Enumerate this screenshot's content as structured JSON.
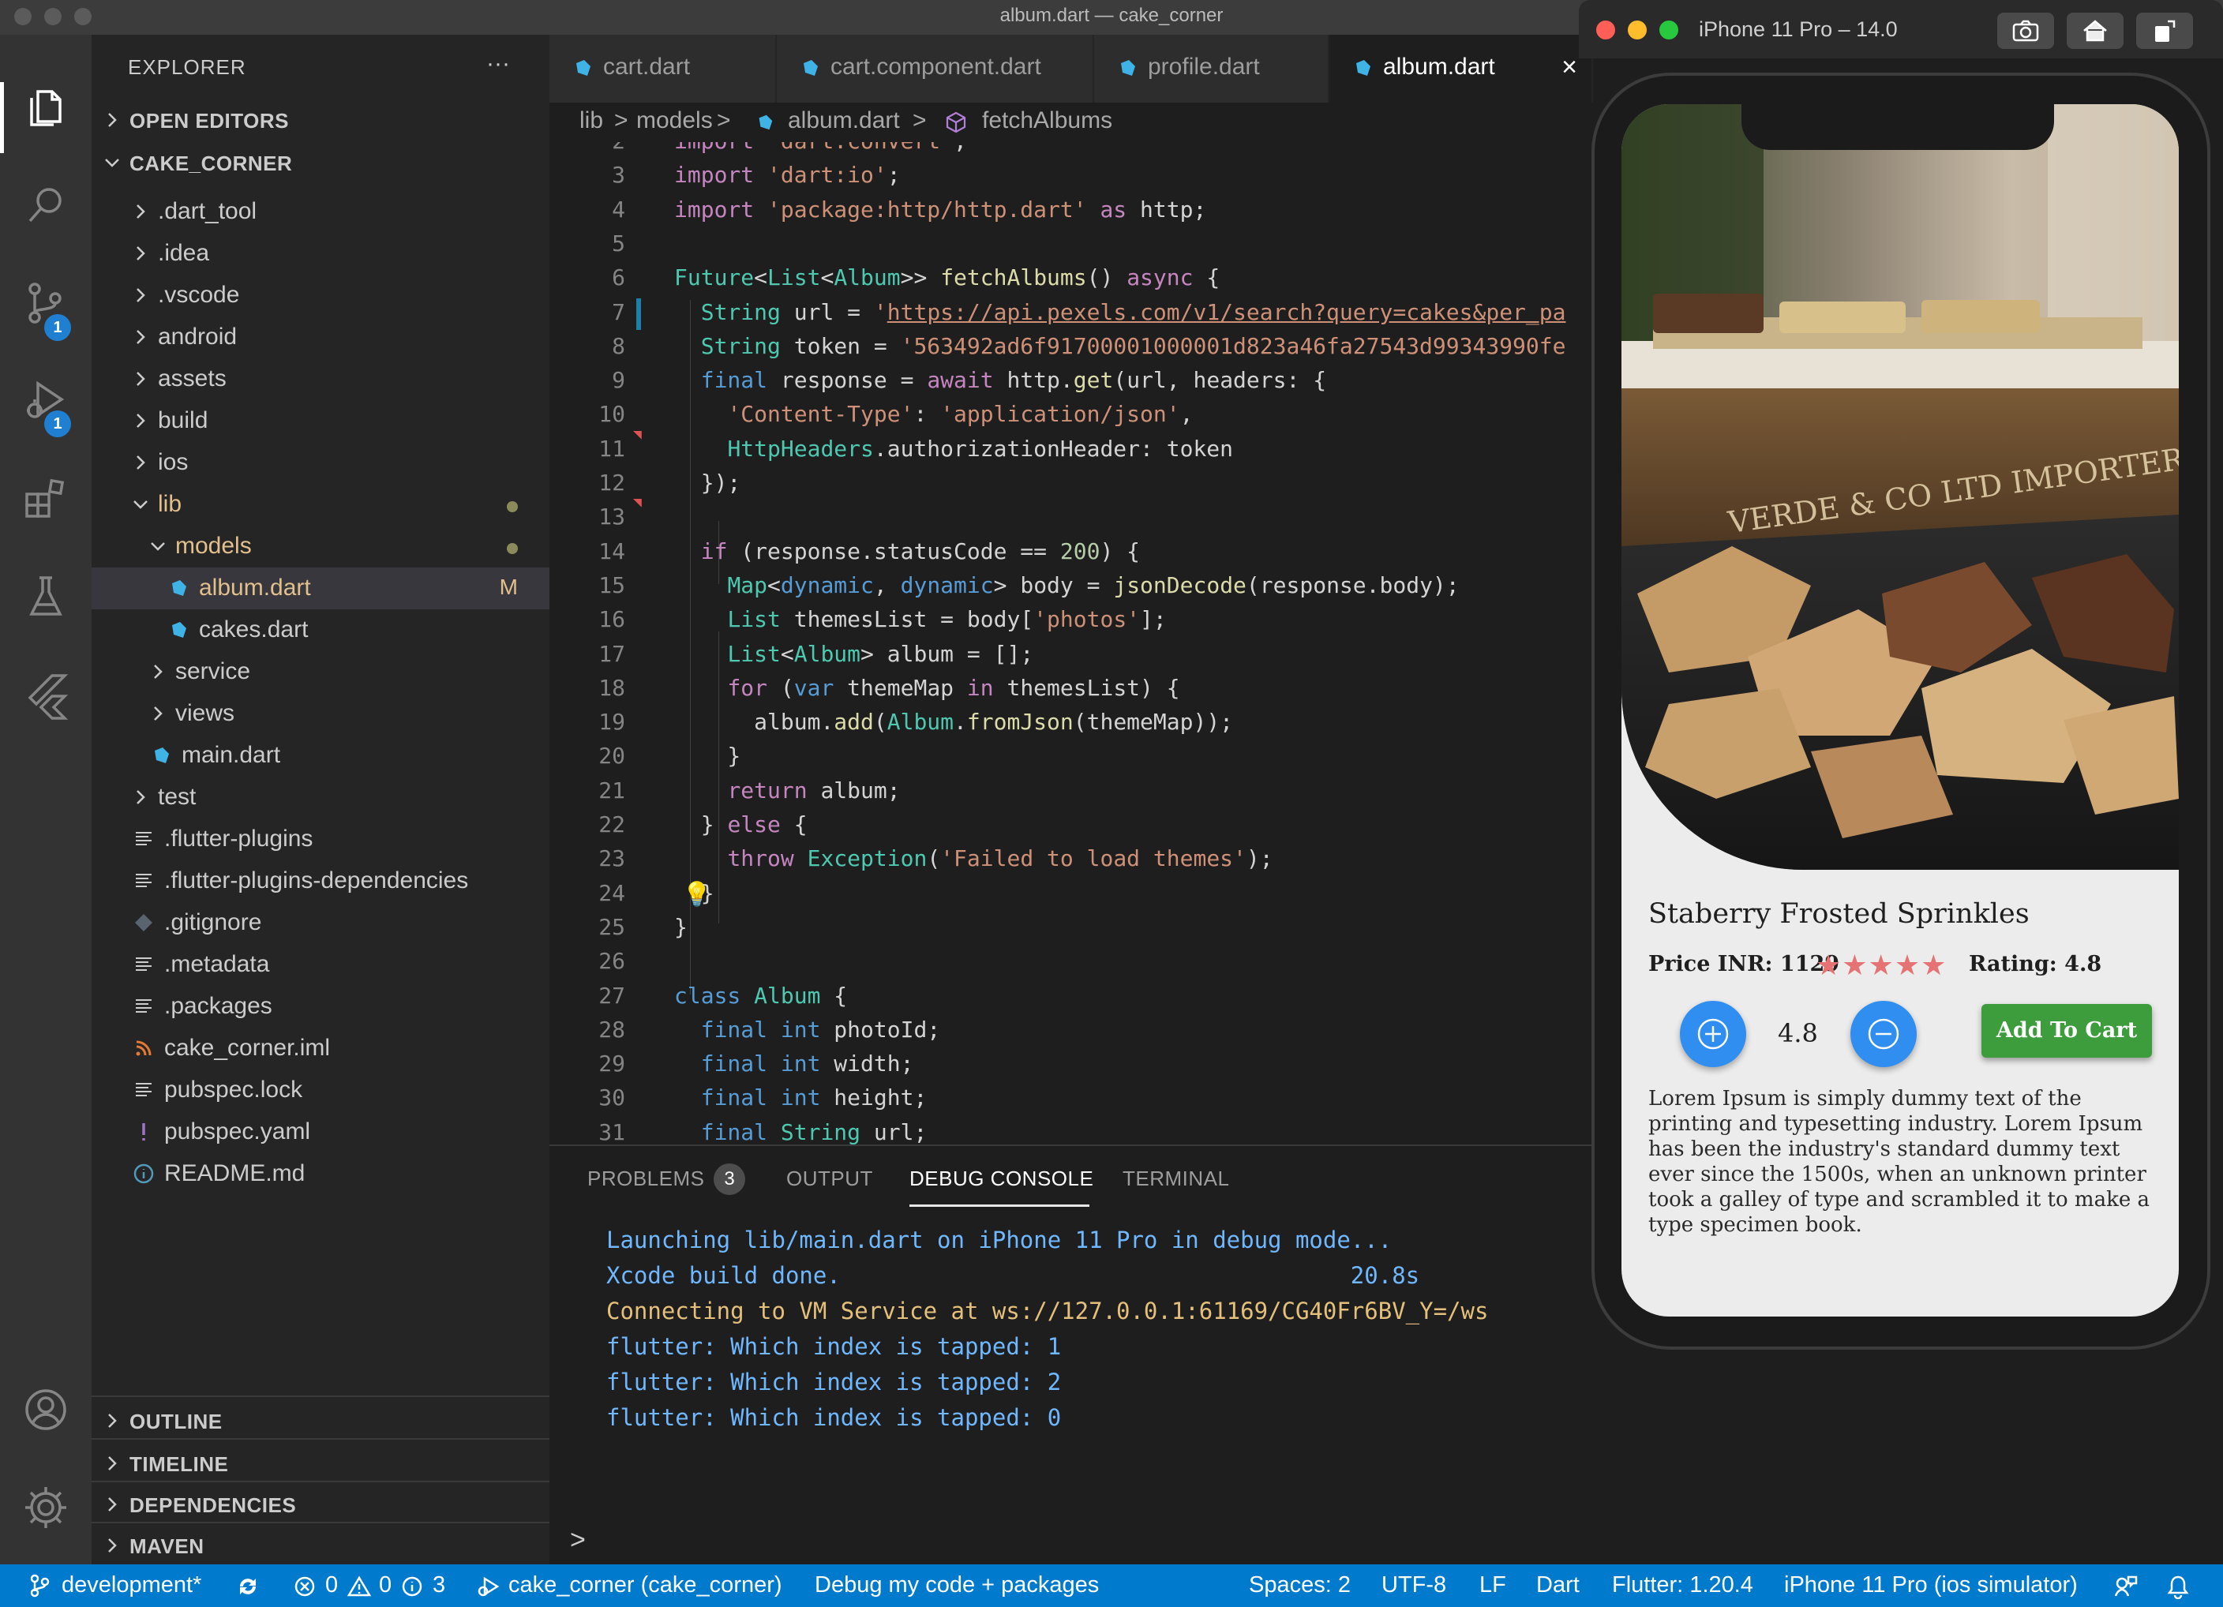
{
  "window": {
    "title": "album.dart — cake_corner"
  },
  "explorer": {
    "title": "EXPLORER",
    "more": "···",
    "open_editors": "OPEN EDITORS",
    "project": "CAKE_CORNER",
    "items": [
      {
        "label": ".dart_tool",
        "type": "folder"
      },
      {
        "label": ".idea",
        "type": "folder"
      },
      {
        "label": ".vscode",
        "type": "folder"
      },
      {
        "label": "android",
        "type": "folder"
      },
      {
        "label": "assets",
        "type": "folder"
      },
      {
        "label": "build",
        "type": "folder"
      },
      {
        "label": "ios",
        "type": "folder"
      },
      {
        "label": "lib",
        "type": "folder-open"
      },
      {
        "label": "models",
        "type": "folder-open"
      },
      {
        "label": "album.dart",
        "type": "dart",
        "badge": "M"
      },
      {
        "label": "cakes.dart",
        "type": "dart"
      },
      {
        "label": "service",
        "type": "folder"
      },
      {
        "label": "views",
        "type": "folder"
      },
      {
        "label": "main.dart",
        "type": "dart"
      },
      {
        "label": "test",
        "type": "folder"
      },
      {
        "label": ".flutter-plugins",
        "type": "file"
      },
      {
        "label": ".flutter-plugins-dependencies",
        "type": "file"
      },
      {
        "label": ".gitignore",
        "type": "git"
      },
      {
        "label": ".metadata",
        "type": "file"
      },
      {
        "label": ".packages",
        "type": "file"
      },
      {
        "label": "cake_corner.iml",
        "type": "rss"
      },
      {
        "label": "pubspec.lock",
        "type": "file"
      },
      {
        "label": "pubspec.yaml",
        "type": "yaml"
      },
      {
        "label": "README.md",
        "type": "info"
      }
    ],
    "bottom_sections": [
      "OUTLINE",
      "TIMELINE",
      "DEPENDENCIES",
      "MAVEN"
    ]
  },
  "activity": {
    "scm_badge": "1",
    "debug_badge": "1"
  },
  "tabs": [
    {
      "label": "cart.dart"
    },
    {
      "label": "cart.component.dart"
    },
    {
      "label": "profile.dart"
    },
    {
      "label": "album.dart",
      "active": true,
      "close": "×"
    }
  ],
  "breadcrumb": {
    "p1": "lib",
    "p2": "models",
    "p3": "album.dart",
    "p4": "fetchAlbums",
    "sep": ">"
  },
  "code": {
    "lines": [
      {
        "n": "2",
        "html": "<span class=\"kw2\">import</span> <span class=\"str\">'dart:convert'</span>;"
      },
      {
        "n": "3",
        "html": "<span class=\"kw2\">import</span> <span class=\"str\">'dart:io'</span>;"
      },
      {
        "n": "4",
        "html": "<span class=\"kw2\">import</span> <span class=\"str\">'package:http/http.dart'</span> <span class=\"kw2\">as</span> http;"
      },
      {
        "n": "5",
        "html": ""
      },
      {
        "n": "6",
        "html": "<span class=\"ty\">Future</span>&lt;<span class=\"ty\">List</span>&lt;<span class=\"ty\">Album</span>&gt;&gt; <span class=\"fn\">fetchAlbums</span>() <span class=\"kw2\">async</span> {"
      },
      {
        "n": "7",
        "html": "  <span class=\"ty\">String</span> url = <span class=\"str\">'</span><span class=\"url\">https://api.pexels.com/v1/search?query=cakes&amp;per_pa</span>"
      },
      {
        "n": "8",
        "html": "  <span class=\"ty\">String</span> token = <span class=\"str\">'563492ad6f91700001000001d823a46fa27543d99343990fe</span>"
      },
      {
        "n": "9",
        "html": "  <span class=\"kw\">final</span> response = <span class=\"kw2\">await</span> http.<span class=\"fn\">get</span>(url, headers: {"
      },
      {
        "n": "10",
        "html": "    <span class=\"str\">'Content-Type'</span>: <span class=\"str\">'application/json'</span>,"
      },
      {
        "n": "11",
        "html": "    <span class=\"ty\">HttpHeaders</span>.authorizationHeader: token"
      },
      {
        "n": "12",
        "html": "  });"
      },
      {
        "n": "13",
        "html": ""
      },
      {
        "n": "14",
        "html": "  <span class=\"kw2\">if</span> (response.statusCode == <span class=\"num\">200</span>) {"
      },
      {
        "n": "15",
        "html": "    <span class=\"ty\">Map</span>&lt;<span class=\"kw\">dynamic</span>, <span class=\"kw\">dynamic</span>&gt; body = <span class=\"fn\">jsonDecode</span>(response.body);"
      },
      {
        "n": "16",
        "html": "    <span class=\"ty\">List</span> themesList = body[<span class=\"str\">'photos'</span>];"
      },
      {
        "n": "17",
        "html": "    <span class=\"ty\">List</span>&lt;<span class=\"ty\">Album</span>&gt; album = [];"
      },
      {
        "n": "18",
        "html": "    <span class=\"kw2\">for</span> (<span class=\"kw\">var</span> themeMap <span class=\"kw2\">in</span> themesList) {"
      },
      {
        "n": "19",
        "html": "      album.<span class=\"fn\">add</span>(<span class=\"ty\">Album</span>.<span class=\"fn\">fromJson</span>(themeMap));"
      },
      {
        "n": "20",
        "html": "    }"
      },
      {
        "n": "21",
        "html": "    <span class=\"kw2\">return</span> album;"
      },
      {
        "n": "22",
        "html": "  } <span class=\"kw2\">else</span> {"
      },
      {
        "n": "23",
        "html": "    <span class=\"kw2\">throw</span> <span class=\"ty\">Exception</span>(<span class=\"str\">'Failed to load themes'</span>);"
      },
      {
        "n": "24",
        "html": "  }"
      },
      {
        "n": "25",
        "html": "}"
      },
      {
        "n": "26",
        "html": ""
      },
      {
        "n": "27",
        "html": "<span class=\"kw\">class</span> <span class=\"ty\">Album</span> {"
      },
      {
        "n": "28",
        "html": "  <span class=\"kw\">final</span> <span class=\"kw\">int</span> photoId;"
      },
      {
        "n": "29",
        "html": "  <span class=\"kw\">final</span> <span class=\"kw\">int</span> width;"
      },
      {
        "n": "30",
        "html": "  <span class=\"kw\">final</span> <span class=\"kw\">int</span> height;"
      },
      {
        "n": "31",
        "html": "  <span class=\"kw\">final</span> <span class=\"ty\">String</span> url;"
      }
    ]
  },
  "panel": {
    "tabs": {
      "problems": "PROBLEMS",
      "problems_count": "3",
      "output": "OUTPUT",
      "debug": "DEBUG CONSOLE",
      "terminal": "TERMINAL"
    },
    "console": [
      {
        "text": "Launching lib/main.dart on iPhone 11 Pro in debug mode...",
        "color": "#6fb8ff"
      },
      {
        "text": "Xcode build done.                                     20.8s",
        "color": "#6fb8ff"
      },
      {
        "text": "Connecting to VM Service at ws://127.0.0.1:61169/CG40Fr6BV_Y=/ws",
        "color": "#e5c07b"
      },
      {
        "text": "flutter: Which index is tapped: 1",
        "color": "#6fb8ff"
      },
      {
        "text": "flutter: Which index is tapped: 2",
        "color": "#6fb8ff"
      },
      {
        "text": "flutter: Which index is tapped: 0",
        "color": "#6fb8ff"
      }
    ],
    "prompt": ">"
  },
  "status": {
    "branch": "development*",
    "errors": "0",
    "warnings": "0",
    "infos": "3",
    "project": "cake_corner (cake_corner)",
    "debug": "Debug my code + packages",
    "spaces": "Spaces: 2",
    "encoding": "UTF-8",
    "eol": "LF",
    "language": "Dart",
    "flutter": "Flutter: 1.20.4",
    "device": "iPhone 11 Pro (ios simulator)"
  },
  "simulator": {
    "title": "iPhone 11 Pro – 14.0",
    "app": {
      "product_title": "Staberry Frosted Sprinkles",
      "price": "Price INR: 1129",
      "stars": "★★★★★",
      "rating": "Rating: 4.8",
      "quantity": "4.8",
      "add_to_cart": "Add To Cart",
      "description": "Lorem Ipsum is simply dummy text of the printing and typesetting industry. Lorem Ipsum has been the industry's standard dummy text ever since the 1500s, when an unknown printer took a galley of type and scrambled it to make a type specimen book.",
      "photo_text": "VERDE & CO LTD IMPORTERS OF FINE FRUITS & VEGETABLES"
    }
  },
  "colors": {
    "accent": "#007acc",
    "sidebar": "#252526",
    "editor": "#1e1e1e",
    "add_to_cart": "#3d9d3d",
    "circle_button": "#2f8ef0",
    "stars": "#e57373"
  }
}
